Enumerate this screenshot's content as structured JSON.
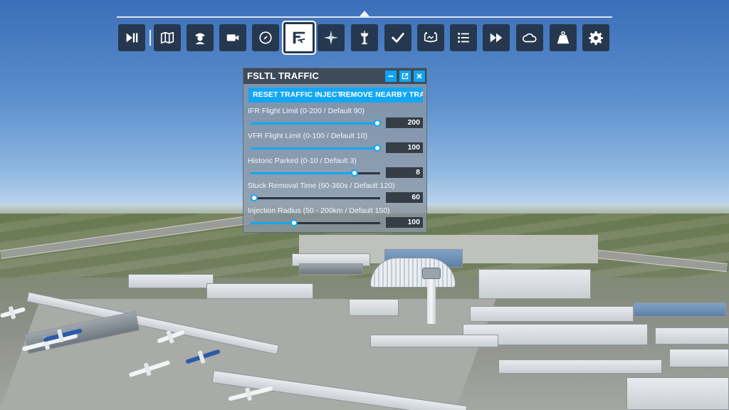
{
  "toolbar": {
    "buttons": [
      {
        "icon": "play-pause-icon"
      },
      {
        "icon": "map-icon"
      },
      {
        "icon": "pilot-icon"
      },
      {
        "icon": "camera-icon"
      },
      {
        "icon": "compass-icon"
      },
      {
        "icon": "fsltl-logo-icon",
        "active": true
      },
      {
        "icon": "nav-star-icon"
      },
      {
        "icon": "atc-tower-icon"
      },
      {
        "icon": "checklist-check-icon"
      },
      {
        "icon": "weight-balance-icon"
      },
      {
        "icon": "list-icon"
      },
      {
        "icon": "fast-forward-icon"
      },
      {
        "icon": "weather-cloud-icon"
      },
      {
        "icon": "weight-icon"
      },
      {
        "icon": "settings-gear-icon"
      }
    ]
  },
  "panel": {
    "title": "FSLTL TRAFFIC",
    "reset_label": "RESET TRAFFIC INJECT",
    "remove_label": "REMOVE NEARBY TRAF",
    "settings": [
      {
        "label": "IFR Flight Limit (0-200 / Default 90)",
        "value": "200",
        "fraction": 1.0
      },
      {
        "label": "VFR Flight Limit (0-100 / Default 10)",
        "value": "100",
        "fraction": 1.0
      },
      {
        "label": "Historic Parked (0-10 / Default 3)",
        "value": "8",
        "fraction": 0.8
      },
      {
        "label": "Stuck Removal Time (60-360s / Default 120)",
        "value": "60",
        "fraction": 0.0
      },
      {
        "label": "Injection Radius (50 - 200km / Default 150)",
        "value": "100",
        "fraction": 0.333
      }
    ]
  },
  "colors": {
    "accent": "#12a7f3",
    "toolbar_button": "#26384f",
    "panel_header": "#374453"
  }
}
